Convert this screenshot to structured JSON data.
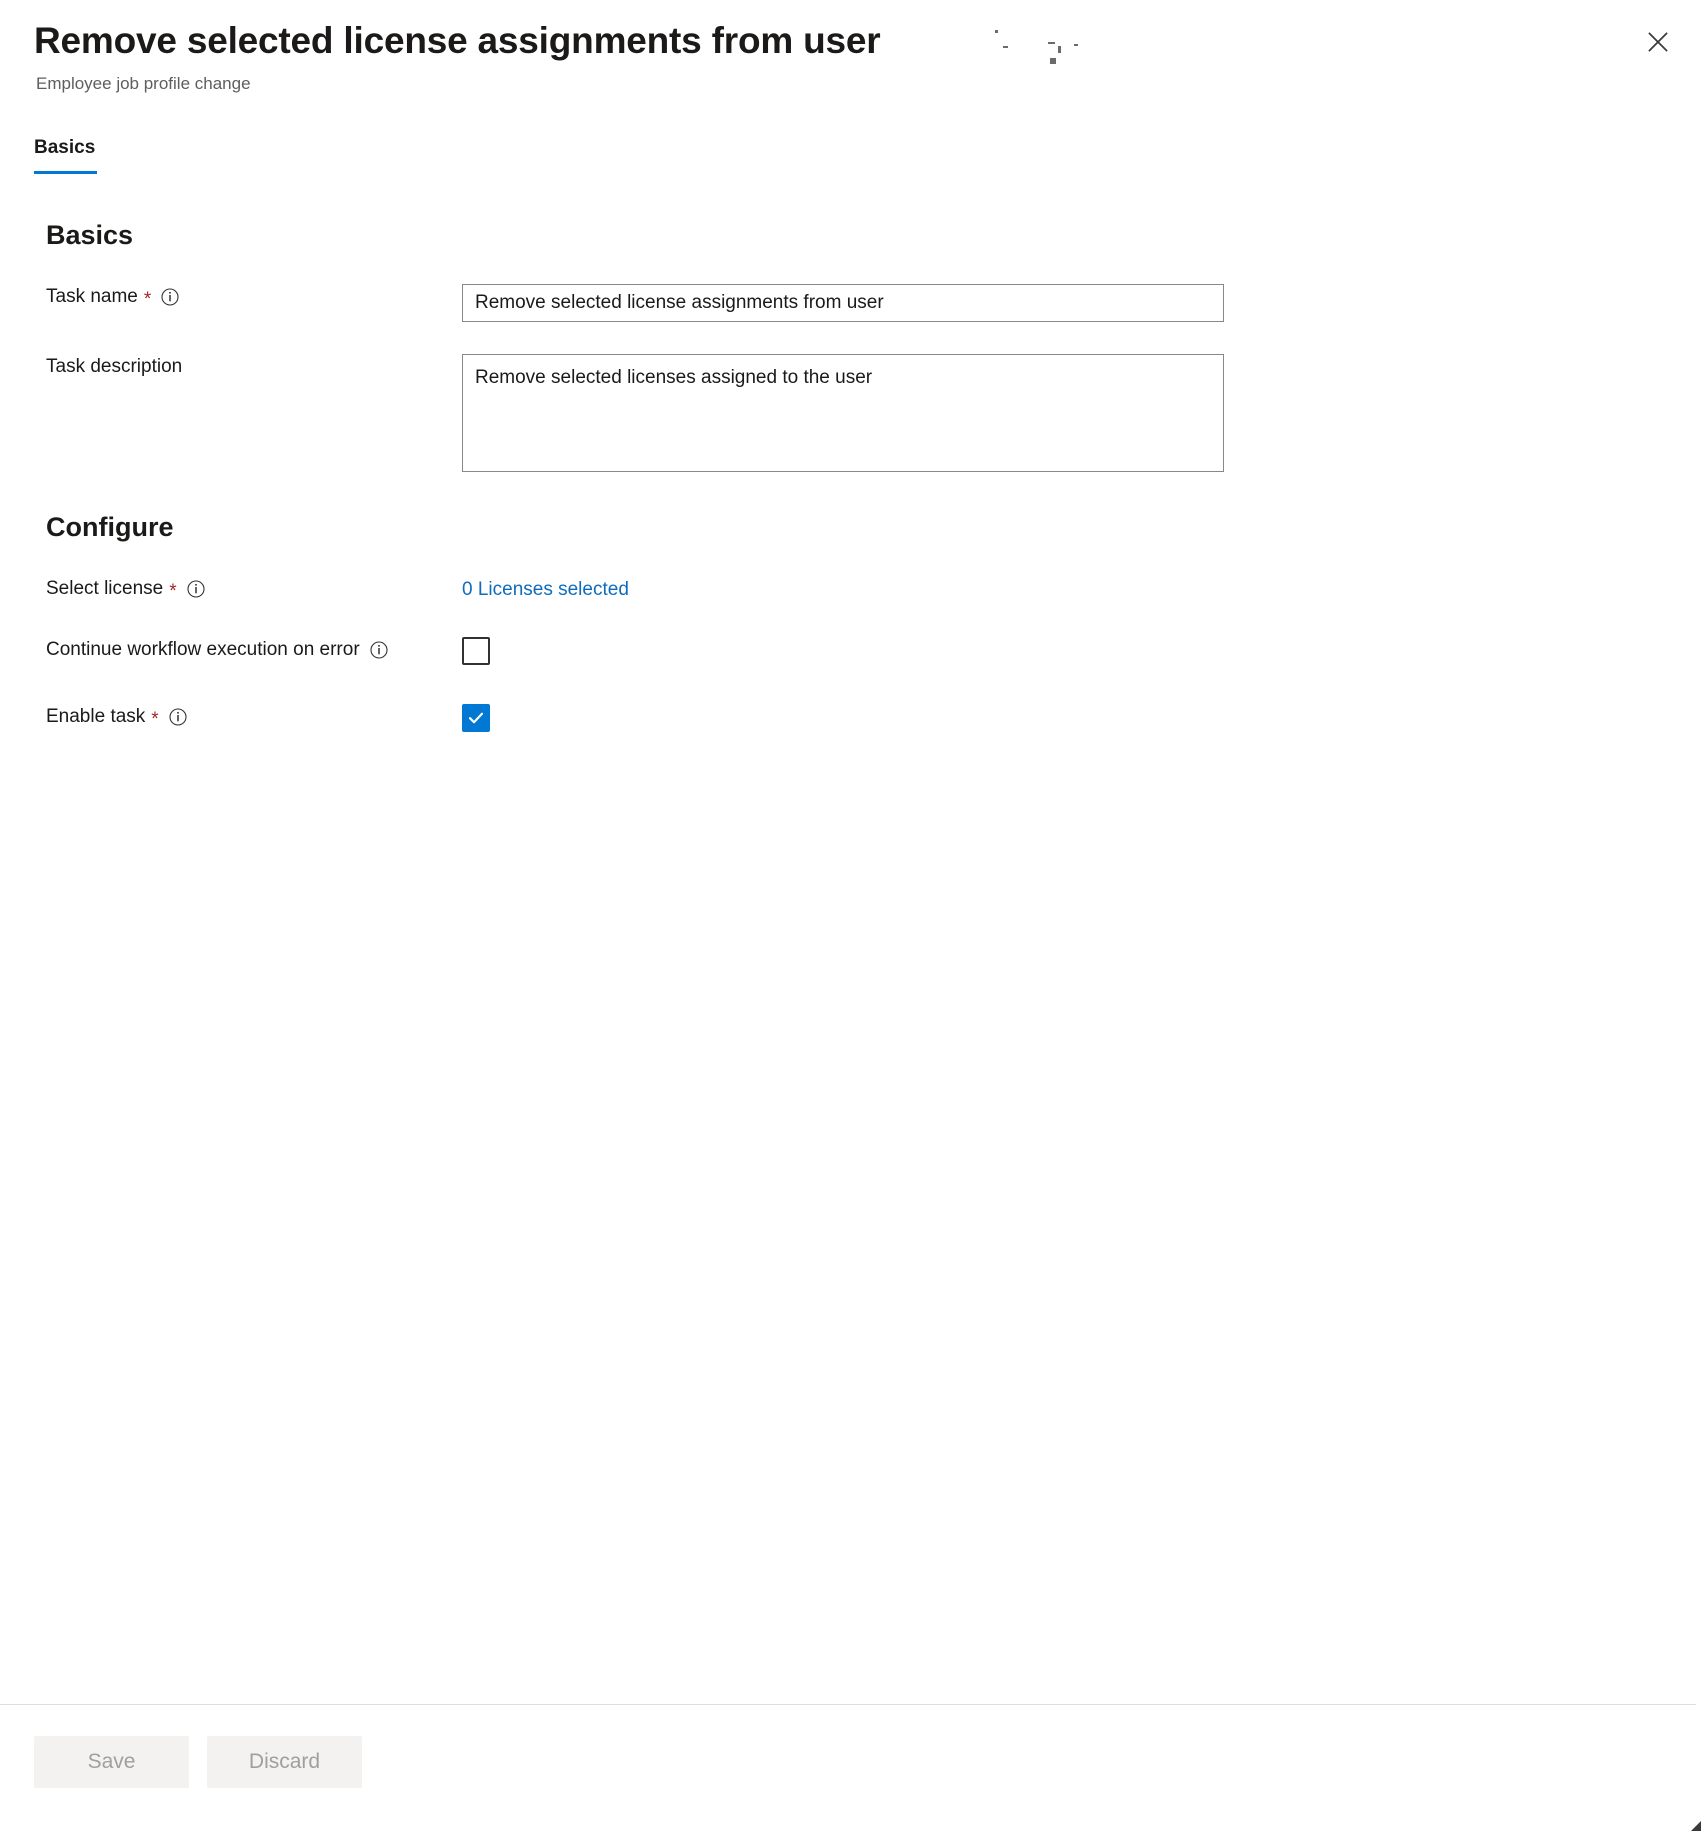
{
  "blade": {
    "title": "Remove selected license assignments from user",
    "subtitle": "Employee job profile change",
    "close_label": "Close"
  },
  "tabs": [
    {
      "label": "Basics",
      "active": true
    }
  ],
  "sections": {
    "basics": {
      "heading": "Basics",
      "task_name": {
        "label": "Task name",
        "required_marker": "*",
        "value": "Remove selected license assignments from user",
        "placeholder": ""
      },
      "task_description": {
        "label": "Task description",
        "value": "Remove selected licenses assigned to the user",
        "placeholder": ""
      }
    },
    "configure": {
      "heading": "Configure",
      "select_license": {
        "label": "Select license",
        "required_marker": "*",
        "link_text": "0 Licenses selected"
      },
      "continue_on_error": {
        "label": "Continue workflow execution on error",
        "checked": false
      },
      "enable_task": {
        "label": "Enable task",
        "required_marker": "*",
        "checked": true
      }
    }
  },
  "footer": {
    "save_label": "Save",
    "discard_label": "Discard"
  },
  "colors": {
    "accent": "#0078d4",
    "link": "#0f6cbd",
    "required": "#a4262c",
    "subtitle": "#605e5c",
    "border": "#8a8886",
    "disabled_bg": "#f3f2f1",
    "disabled_text": "#a19f9d"
  }
}
